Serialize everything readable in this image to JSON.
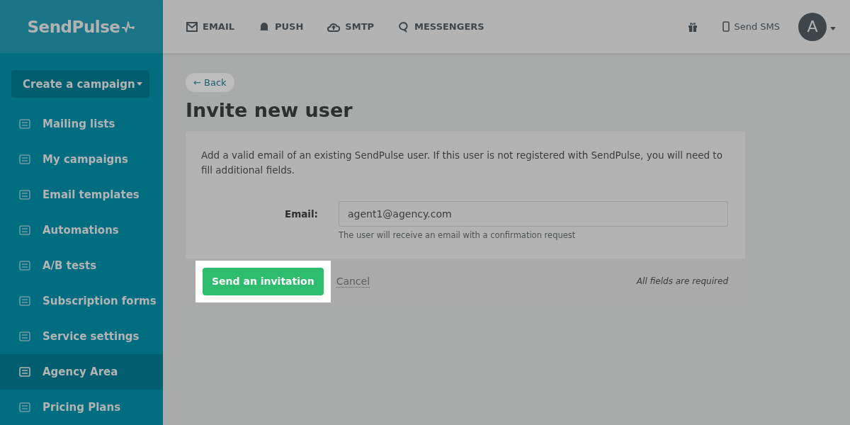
{
  "logo": "SendPulse",
  "top_nav": [
    {
      "kind": "email",
      "label": "EMAIL"
    },
    {
      "kind": "push",
      "label": "PUSH"
    },
    {
      "kind": "smtp",
      "label": "SMTP"
    },
    {
      "kind": "messengers",
      "label": "MESSENGERS"
    }
  ],
  "send_sms": "Send SMS",
  "avatar": "A",
  "create_button": "Create a campaign",
  "sidebar": {
    "items": [
      {
        "kind": "lists",
        "label": "Mailing lists",
        "selected": false
      },
      {
        "kind": "campaigns",
        "label": "My campaigns",
        "selected": false
      },
      {
        "kind": "templates",
        "label": "Email templates",
        "selected": false
      },
      {
        "kind": "automations",
        "label": "Automations",
        "selected": false
      },
      {
        "kind": "ab",
        "label": "A/B tests",
        "selected": false
      },
      {
        "kind": "forms",
        "label": "Subscription forms",
        "selected": false
      },
      {
        "kind": "settings",
        "label": "Service settings",
        "selected": false
      },
      {
        "kind": "agency",
        "label": "Agency Area",
        "selected": true
      },
      {
        "kind": "pricing",
        "label": "Pricing Plans",
        "selected": false
      }
    ]
  },
  "back": "← Back",
  "title": "Invite new user",
  "intro": "Add a valid email of an existing SendPulse user. If this user is not registered with SendPulse, you will need to fill additional fields.",
  "email_label": "Email:",
  "email_value": "agent1@agency.com",
  "email_hint": "The user will receive an email with a confirmation request",
  "submit": "Send an invitation",
  "cancel": "Cancel",
  "required_note": "All fields are required"
}
